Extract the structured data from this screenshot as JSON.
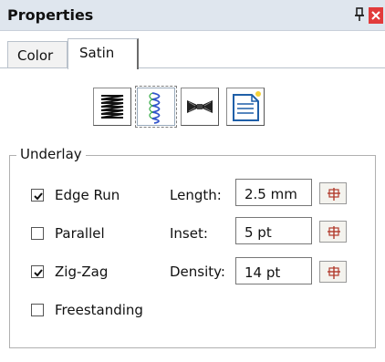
{
  "window": {
    "title": "Properties",
    "pin_icon": "pin-icon",
    "close_icon": "close-icon"
  },
  "tabs": [
    {
      "label": "Color",
      "active": false
    },
    {
      "label": "Satin",
      "active": true
    }
  ],
  "toolbar": {
    "buttons": [
      {
        "icon": "zigzag-satin-icon",
        "selected": false
      },
      {
        "icon": "running-stitch-icon",
        "selected": true
      },
      {
        "icon": "bowtie-icon",
        "selected": false
      },
      {
        "icon": "document-icon",
        "selected": false
      }
    ]
  },
  "underlay": {
    "legend": "Underlay",
    "checkboxes": [
      {
        "label": "Edge Run",
        "checked": true
      },
      {
        "label": "Parallel",
        "checked": false
      },
      {
        "label": "Zig-Zag",
        "checked": true
      },
      {
        "label": "Freestanding",
        "checked": false
      }
    ],
    "fields": [
      {
        "label": "Length:",
        "value": "2.5 mm"
      },
      {
        "label": "Inset:",
        "value": "5 pt"
      },
      {
        "label": "Density:",
        "value": "14 pt"
      }
    ],
    "picker_icon": "position-picker-icon"
  },
  "colors": {
    "titlebar": "#dfe6ee",
    "close": "#e23b3b",
    "picker_bg": "#f4f3ee"
  }
}
